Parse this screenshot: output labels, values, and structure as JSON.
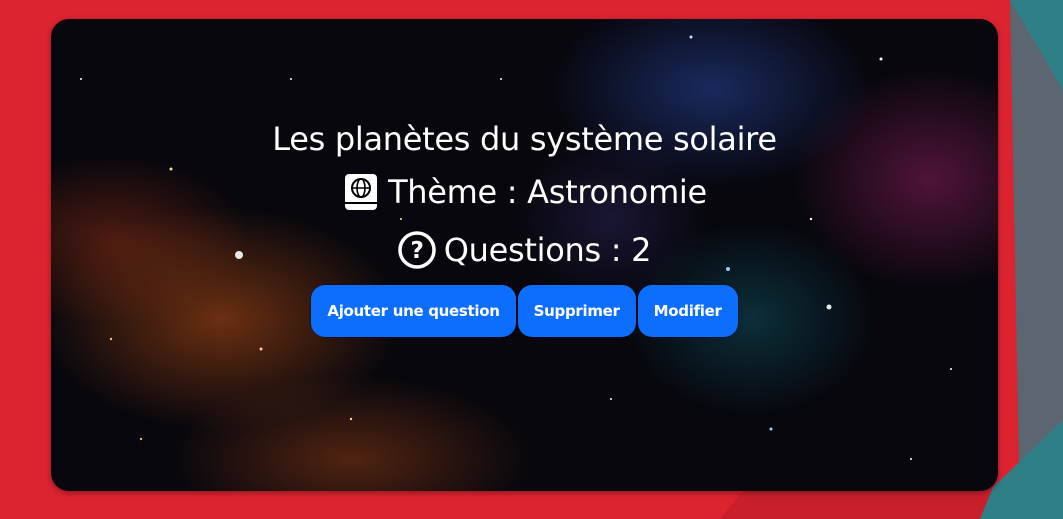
{
  "quiz": {
    "title": "Les planètes du système solaire",
    "theme_label": "Thème : Astronomie",
    "questions_label": "Questions : 2",
    "theme_icon": "book-globe-icon",
    "questions_icon": "question-circle-icon"
  },
  "actions": {
    "add_question": "Ajouter une question",
    "delete": "Supprimer",
    "edit": "Modifier"
  },
  "colors": {
    "background_red": "#dc2330",
    "accent_teal": "#2e7f86",
    "accent_slate": "#5b6670",
    "button_blue": "#0d6efd"
  }
}
